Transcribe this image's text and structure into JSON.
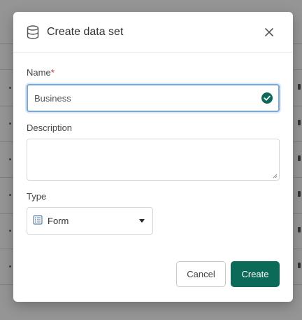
{
  "dialog": {
    "title": "Create data set",
    "title_icon": "database-icon",
    "close_icon": "close-icon"
  },
  "form": {
    "name": {
      "label": "Name",
      "required_mark": "*",
      "value": "Business",
      "status_icon": "check-circle-icon"
    },
    "description": {
      "label": "Description",
      "value": ""
    },
    "type": {
      "label": "Type",
      "selected": "Form",
      "selected_icon": "form-icon",
      "dropdown_icon": "caret-down-icon"
    }
  },
  "actions": {
    "cancel_label": "Cancel",
    "create_label": "Create"
  },
  "colors": {
    "primary": "#0b6b58",
    "focus_border": "#7ca7d3",
    "required": "#d32f2f",
    "form_icon": "#5b7fb5"
  }
}
